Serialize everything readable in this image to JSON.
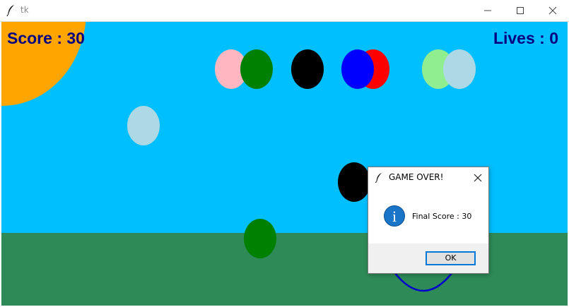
{
  "window": {
    "title": "tk",
    "buttons": [
      "minimize-icon",
      "maximize-icon",
      "close-icon"
    ]
  },
  "game": {
    "hud": {
      "score_text": "Score : 30",
      "lives_text": "Lives : 0"
    },
    "colors": {
      "sky": "#00bfff",
      "ground": "#2e8b57",
      "sun": "#ffa500",
      "hud_text": "#000080",
      "basket": "#0000cd"
    },
    "balloons": [
      {
        "color": "#ffb6c1"
      },
      {
        "color": "#008000"
      },
      {
        "color": "#000000"
      },
      {
        "color": "#ff0000"
      },
      {
        "color": "#0000ff"
      },
      {
        "color": "#90ee90"
      },
      {
        "color": "#add8e6"
      },
      {
        "color": "#add8e6"
      },
      {
        "color": "#000000"
      },
      {
        "color": "#008000"
      }
    ]
  },
  "dialog": {
    "title": "GAME OVER!",
    "icon": "info-icon",
    "message": "Final Score : 30",
    "ok_label": "OK"
  }
}
